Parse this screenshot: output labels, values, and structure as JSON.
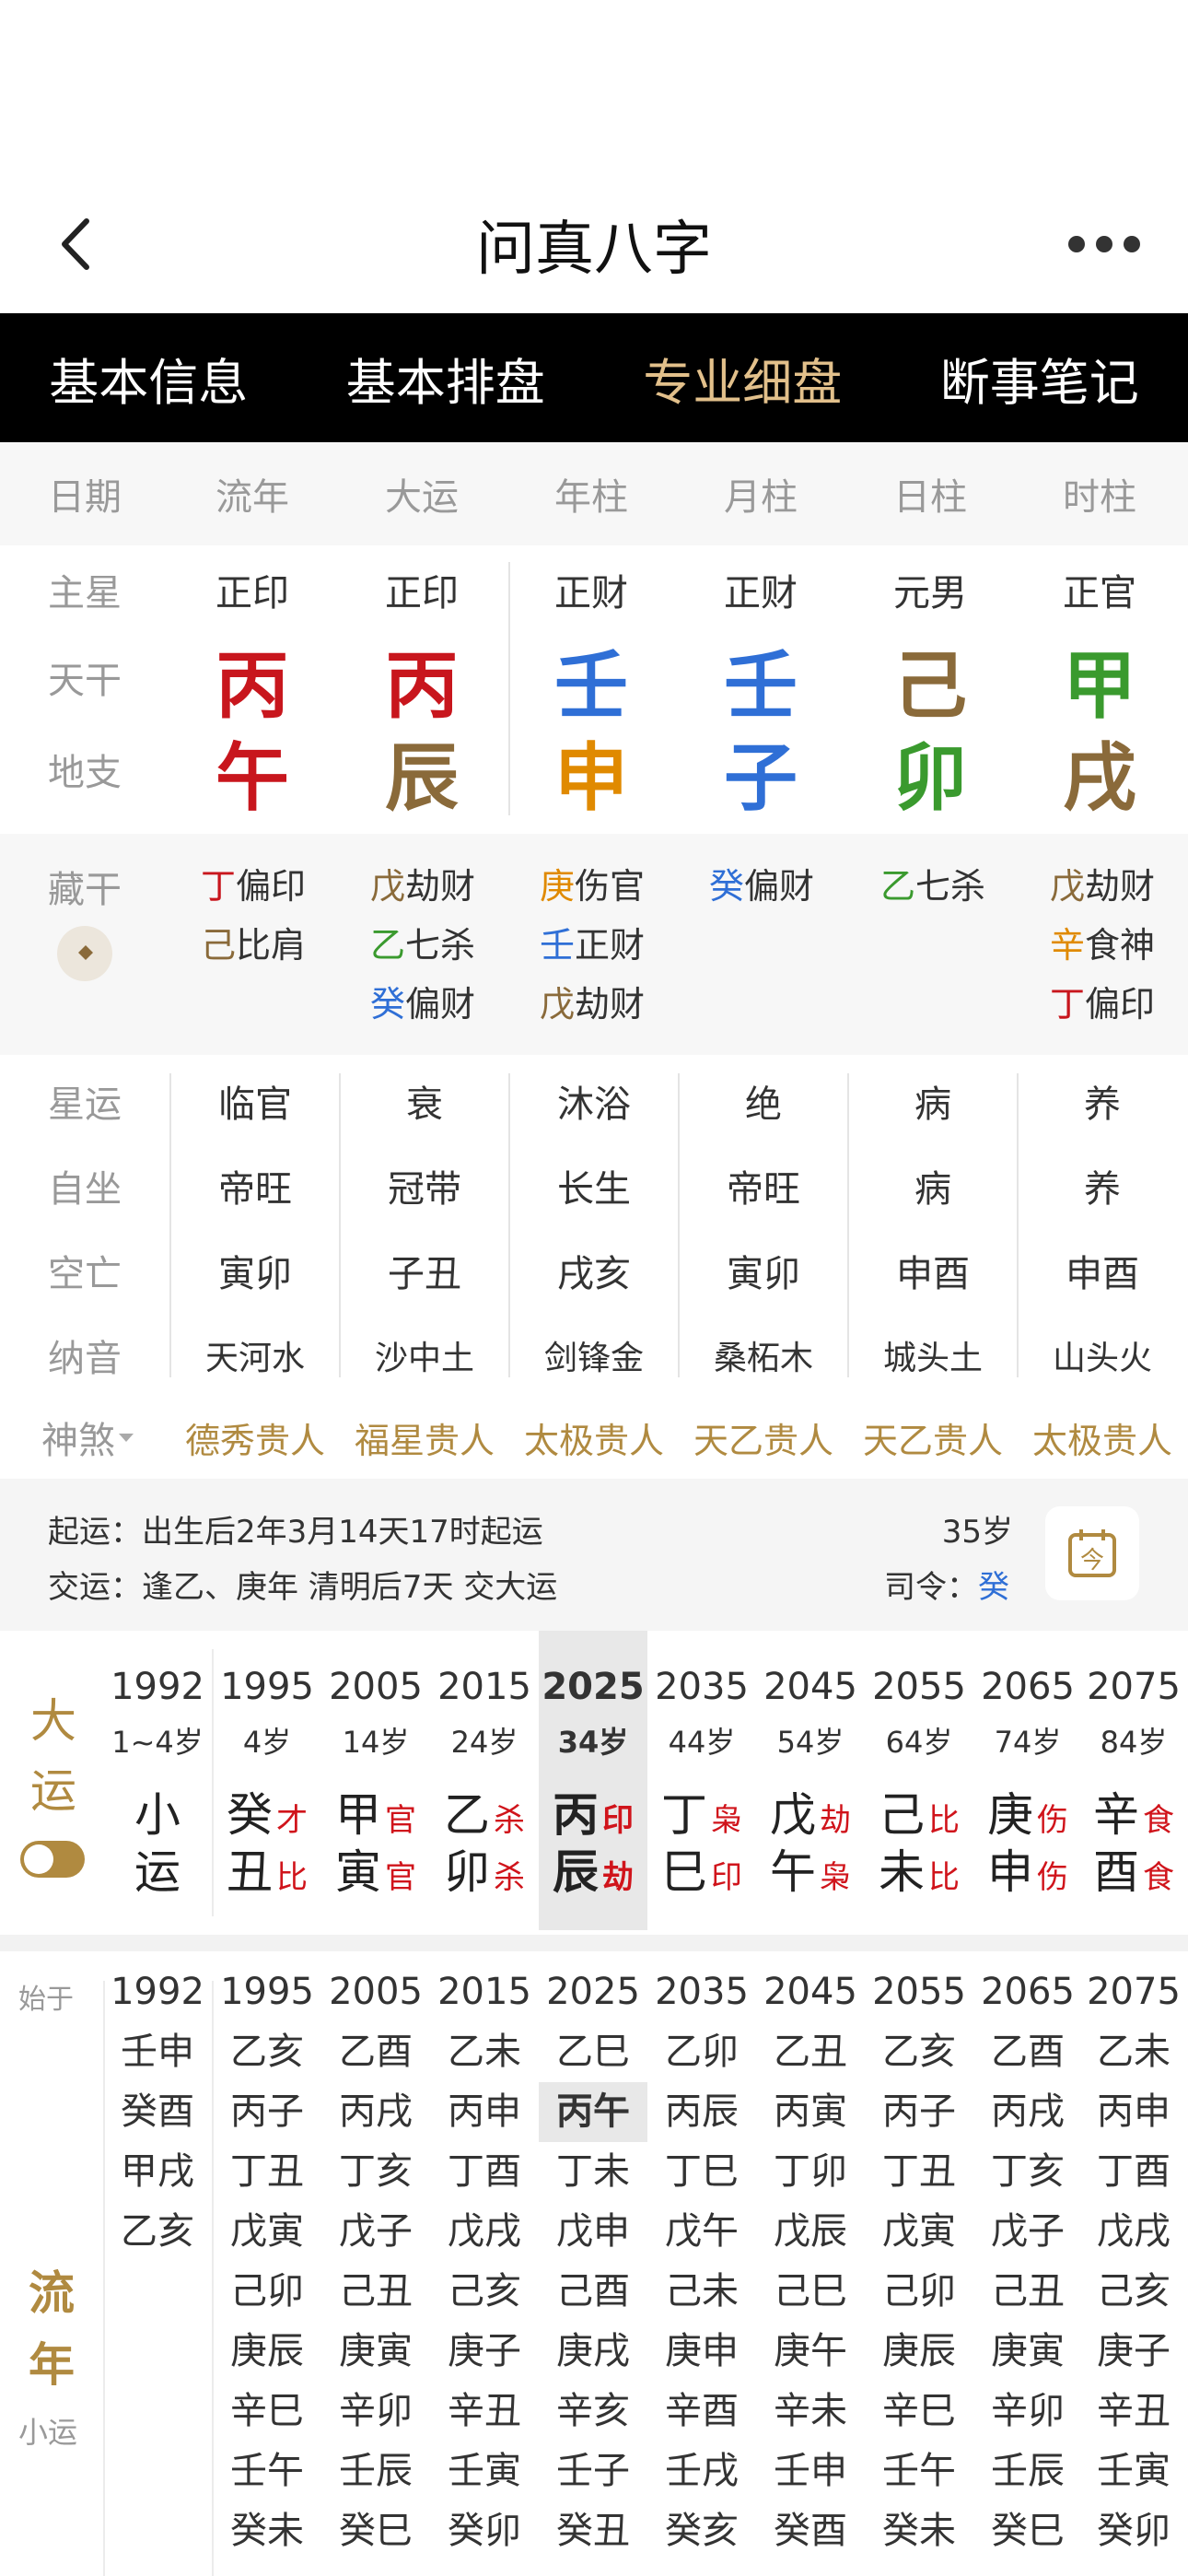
{
  "nav": {
    "title": "问真八字"
  },
  "tabs": [
    "基本信息",
    "基本排盘",
    "专业细盘",
    "断事笔记"
  ],
  "header_row": [
    "日期",
    "流年",
    "大运",
    "年柱",
    "月柱",
    "日柱",
    "时柱"
  ],
  "labels": {
    "zhuxing": "主星",
    "tiangan": "天干",
    "dizhi": "地支",
    "canggan": "藏干",
    "xingyun": "星运",
    "zizuo": "自坐",
    "kongwang": "空亡",
    "nayin": "纳音",
    "shensha": "神煞"
  },
  "zhuxing": [
    "正印",
    "正印",
    "正财",
    "正财",
    "元男",
    "正官"
  ],
  "tiangan": [
    "丙",
    "丙",
    "壬",
    "壬",
    "己",
    "甲"
  ],
  "dizhi": [
    "午",
    "辰",
    "申",
    "子",
    "卯",
    "戌"
  ],
  "canggan": [
    [
      {
        "g": "丁",
        "t": "偏印"
      },
      {
        "g": "己",
        "t": "比肩"
      }
    ],
    [
      {
        "g": "戊",
        "t": "劫财"
      },
      {
        "g": "乙",
        "t": "七杀"
      },
      {
        "g": "癸",
        "t": "偏财"
      }
    ],
    [
      {
        "g": "庚",
        "t": "伤官"
      },
      {
        "g": "壬",
        "t": "正财"
      },
      {
        "g": "戊",
        "t": "劫财"
      }
    ],
    [
      {
        "g": "癸",
        "t": "偏财"
      }
    ],
    [
      {
        "g": "乙",
        "t": "七杀"
      }
    ],
    [
      {
        "g": "戊",
        "t": "劫财"
      },
      {
        "g": "辛",
        "t": "食神"
      },
      {
        "g": "丁",
        "t": "偏印"
      }
    ]
  ],
  "xingyun": [
    "临官",
    "衰",
    "沐浴",
    "绝",
    "病",
    "养"
  ],
  "zizuo": [
    "帝旺",
    "冠带",
    "长生",
    "帝旺",
    "病",
    "养"
  ],
  "kongwang": [
    "寅卯",
    "子丑",
    "戌亥",
    "寅卯",
    "申酉",
    "申酉"
  ],
  "nayin": [
    "天河水",
    "沙中土",
    "剑锋金",
    "桑柘木",
    "城头土",
    "山头火"
  ],
  "shensha": [
    "德秀贵人",
    "福星贵人",
    "太极贵人",
    "天乙贵人",
    "天乙贵人",
    "太极贵人"
  ],
  "info": {
    "qiyun_label": "起运：",
    "qiyun": "出生后2年3月14天17时起运",
    "jiaoyun_label": "交运：",
    "jiaoyun": "逢乙、庚年 清明后7天 交大运",
    "age": "35岁",
    "siling_label": "司令：",
    "siling": "癸"
  },
  "dayun_label": [
    "大",
    "运"
  ],
  "dayun": [
    {
      "year": "1992",
      "age": "1~4岁",
      "g": "小",
      "z": "运",
      "gs": "",
      "zs": ""
    },
    {
      "year": "1995",
      "age": "4岁",
      "g": "癸",
      "gs": "才",
      "z": "丑",
      "zs": "比"
    },
    {
      "year": "2005",
      "age": "14岁",
      "g": "甲",
      "gs": "官",
      "z": "寅",
      "zs": "官"
    },
    {
      "year": "2015",
      "age": "24岁",
      "g": "乙",
      "gs": "杀",
      "z": "卯",
      "zs": "杀"
    },
    {
      "year": "2025",
      "age": "34岁",
      "g": "丙",
      "gs": "印",
      "z": "辰",
      "zs": "劫"
    },
    {
      "year": "2035",
      "age": "44岁",
      "g": "丁",
      "gs": "枭",
      "z": "巳",
      "zs": "印"
    },
    {
      "year": "2045",
      "age": "54岁",
      "g": "戊",
      "gs": "劫",
      "z": "午",
      "zs": "枭"
    },
    {
      "year": "2055",
      "age": "64岁",
      "g": "己",
      "gs": "比",
      "z": "未",
      "zs": "比"
    },
    {
      "year": "2065",
      "age": "74岁",
      "g": "庚",
      "gs": "伤",
      "z": "申",
      "zs": "伤"
    },
    {
      "year": "2075",
      "age": "84岁",
      "g": "辛",
      "gs": "食",
      "z": "酉",
      "zs": "食"
    }
  ],
  "liunian_labels": {
    "start": "始于",
    "title": [
      "流",
      "年"
    ],
    "sub": "小运"
  },
  "liunian": [
    [
      "1992",
      "壬申",
      "癸酉",
      "甲戌",
      "乙亥"
    ],
    [
      "1995",
      "乙亥",
      "丙子",
      "丁丑",
      "戊寅",
      "己卯",
      "庚辰",
      "辛巳",
      "壬午",
      "癸未"
    ],
    [
      "2005",
      "乙酉",
      "丙戌",
      "丁亥",
      "戊子",
      "己丑",
      "庚寅",
      "辛卯",
      "壬辰",
      "癸巳"
    ],
    [
      "2015",
      "乙未",
      "丙申",
      "丁酉",
      "戊戌",
      "己亥",
      "庚子",
      "辛丑",
      "壬寅",
      "癸卯"
    ],
    [
      "2025",
      "乙巳",
      "丙午",
      "丁未",
      "戊申",
      "己酉",
      "庚戌",
      "辛亥",
      "壬子",
      "癸丑"
    ],
    [
      "2035",
      "乙卯",
      "丙辰",
      "丁巳",
      "戊午",
      "己未",
      "庚申",
      "辛酉",
      "壬戌",
      "癸亥"
    ],
    [
      "2045",
      "乙丑",
      "丙寅",
      "丁卯",
      "戊辰",
      "己巳",
      "庚午",
      "辛未",
      "壬申",
      "癸酉"
    ],
    [
      "2055",
      "乙亥",
      "丙子",
      "丁丑",
      "戊寅",
      "己卯",
      "庚辰",
      "辛巳",
      "壬午",
      "癸未"
    ],
    [
      "2065",
      "乙酉",
      "丙戌",
      "丁亥",
      "戊子",
      "己丑",
      "庚寅",
      "辛卯",
      "壬辰",
      "癸巳"
    ],
    [
      "2075",
      "乙未",
      "丙申",
      "丁酉",
      "戊戌",
      "己亥",
      "庚子",
      "辛丑",
      "壬寅",
      "癸卯"
    ]
  ],
  "colors": {
    "accent": "#e2c08b",
    "red": "#c8161d",
    "blue": "#2f6fd6",
    "brown": "#8a6a3a",
    "orange": "#e08a00",
    "green": "#3a9a2e"
  }
}
